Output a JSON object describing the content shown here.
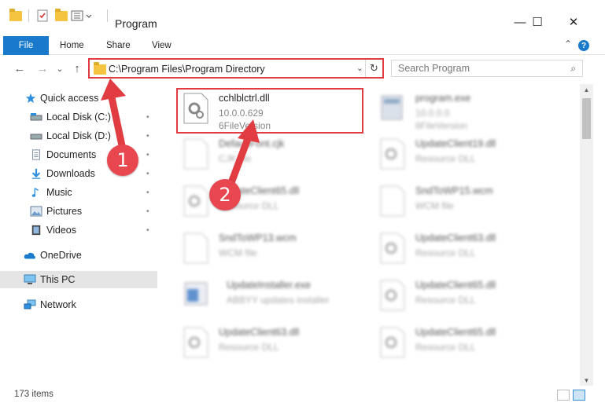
{
  "window": {
    "title": "Program"
  },
  "ribbon": {
    "file": "File",
    "home": "Home",
    "share": "Share",
    "view": "View",
    "help": "?"
  },
  "address": {
    "path": "C:\\Program Files\\Program Directory",
    "dropdown": "⌄",
    "refresh": "↻"
  },
  "search": {
    "placeholder": "Search Program",
    "icon": "⌕"
  },
  "nav": {
    "back": "←",
    "forward": "→",
    "recent": "⌄",
    "up": "↑",
    "items": [
      {
        "label": "Quick access",
        "icon": "star-icon"
      },
      {
        "label": "Local Disk (C:)",
        "icon": "drive-icon",
        "pinned": true
      },
      {
        "label": "Local Disk (D:)",
        "icon": "drive-icon",
        "pinned": true
      },
      {
        "label": "Documents",
        "icon": "documents-icon",
        "pinned": true
      },
      {
        "label": "Downloads",
        "icon": "download-icon",
        "pinned": true
      },
      {
        "label": "Music",
        "icon": "music-icon",
        "pinned": true
      },
      {
        "label": "Pictures",
        "icon": "pictures-icon",
        "pinned": true
      },
      {
        "label": "Videos",
        "icon": "videos-icon",
        "pinned": true
      },
      {
        "label": "OneDrive",
        "icon": "cloud-icon"
      },
      {
        "label": "This PC",
        "icon": "pc-icon",
        "selected": true
      },
      {
        "label": "Network",
        "icon": "network-icon"
      }
    ],
    "pin_glyph": "📌"
  },
  "files": [
    {
      "name": "cchlblctrl.dll",
      "line2": "10.0.0.629",
      "line3": "6FileVersion",
      "icon": "dll-gear-icon"
    },
    {
      "name": "program.exe",
      "line2": "10.0.0.0",
      "line3": "6FileVersion",
      "icon": "exe-icon"
    },
    {
      "name": "DefaultFont.cjk",
      "line2": "CJK file",
      "line3": "",
      "icon": "blank-file-icon"
    },
    {
      "name": "UpdateClient19.dll",
      "line2": "Resource DLL",
      "line3": "",
      "icon": "dll-gear-icon"
    },
    {
      "name": "UpdateClient65.dll",
      "line2": "Resource DLL",
      "line3": "",
      "icon": "dll-gear-icon"
    },
    {
      "name": "SndToWP15.wcm",
      "line2": "WCM file",
      "line3": "",
      "icon": "blank-file-icon"
    },
    {
      "name": "SndToWP13.wcm",
      "line2": "WCM file",
      "line3": "",
      "icon": "blank-file-icon"
    },
    {
      "name": "UpdateClient63.dll",
      "line2": "Resource DLL",
      "line3": "",
      "icon": "dll-gear-icon"
    },
    {
      "name": "UpdateInstaller.exe",
      "line2": "ABBYY updates installer",
      "line3": "",
      "icon": "installer-icon"
    },
    {
      "name": "UpdateClient65.dll",
      "line2": "Resource DLL",
      "line3": "",
      "icon": "dll-gear-icon"
    },
    {
      "name": "UpdateClient63.dll",
      "line2": "Resource DLL",
      "line3": "",
      "icon": "dll-gear-icon"
    },
    {
      "name": "UpdateClient65.dll",
      "line2": "Resource DLL",
      "line3": "",
      "icon": "dll-gear-icon"
    }
  ],
  "status": {
    "count": "173 items"
  },
  "markers": {
    "one": "1",
    "two": "2"
  },
  "colors": {
    "accent": "#1979ca",
    "highlight": "#e23c43",
    "marker": "#e8474f"
  }
}
